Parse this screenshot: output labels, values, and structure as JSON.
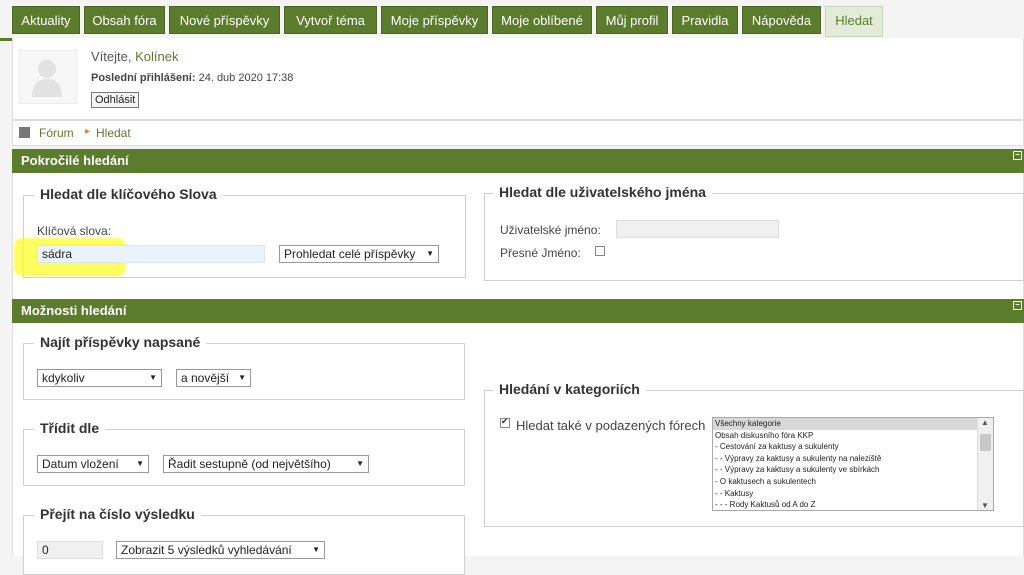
{
  "tabs": [
    {
      "label": "Aktuality",
      "active": false
    },
    {
      "label": "Obsah fóra",
      "active": false
    },
    {
      "label": "Nové příspěvky",
      "active": false
    },
    {
      "label": "Vytvoř téma",
      "active": false
    },
    {
      "label": "Moje příspěvky",
      "active": false
    },
    {
      "label": "Moje oblíbené",
      "active": false
    },
    {
      "label": "Můj profil",
      "active": false
    },
    {
      "label": "Pravidla",
      "active": false
    },
    {
      "label": "Nápověda",
      "active": false
    },
    {
      "label": "Hledat",
      "active": true
    }
  ],
  "welcome": {
    "greeting": "Vítejte,",
    "username": "Kolínek",
    "last_login_label": "Poslední přihlášení:",
    "last_login_value": "24. dub 2020 17:38",
    "logout": "Odhlásit"
  },
  "breadcrumb": {
    "forum": "Fórum",
    "arrow": "▸",
    "current": "Hledat"
  },
  "advanced": {
    "title": "Pokročilé hledání",
    "keyword": {
      "legend": "Hledat dle klíčového Slova",
      "label": "Klíčová slova:",
      "value": "sádra",
      "scope_select": "Prohledat celé příspěvky"
    },
    "user": {
      "legend": "Hledat dle uživatelského jména",
      "username_label": "Uživatelské jméno:",
      "username_value": "",
      "exact_label": "Přesné Jméno:"
    }
  },
  "options": {
    "title": "Možnosti hledání",
    "posted": {
      "legend": "Najít příspěvky napsané",
      "period": "kdykoliv",
      "direction": "a novější"
    },
    "sort": {
      "legend": "Třídit dle",
      "field": "Datum vložení",
      "order": "Řadit sestupně (od největšího)"
    },
    "jump": {
      "legend": "Přejít na číslo výsledku",
      "value": "0",
      "per_page": "Zobrazit 5 výsledků vyhledávání"
    },
    "categories": {
      "legend": "Hledání v kategoriích",
      "subforums_label": "Hledat také v podazených fórech",
      "subforums_checked": true,
      "items": [
        "Všechny kategorie",
        "Obsah diskusního fóra KKP",
        "- Cestování za kaktusy a sukulenty",
        "- - Výpravy za kaktusy a sukulenty na naleziště",
        "- - Výpravy za kaktusy a sukulenty ve sbírkách",
        "- O kaktusech a sukulentech",
        "- - Kaktusy",
        "- - - Rody Kaktusů od A do Z"
      ]
    }
  },
  "colors": {
    "accent": "#5b7c2c",
    "highlight": "#fdfd35"
  }
}
